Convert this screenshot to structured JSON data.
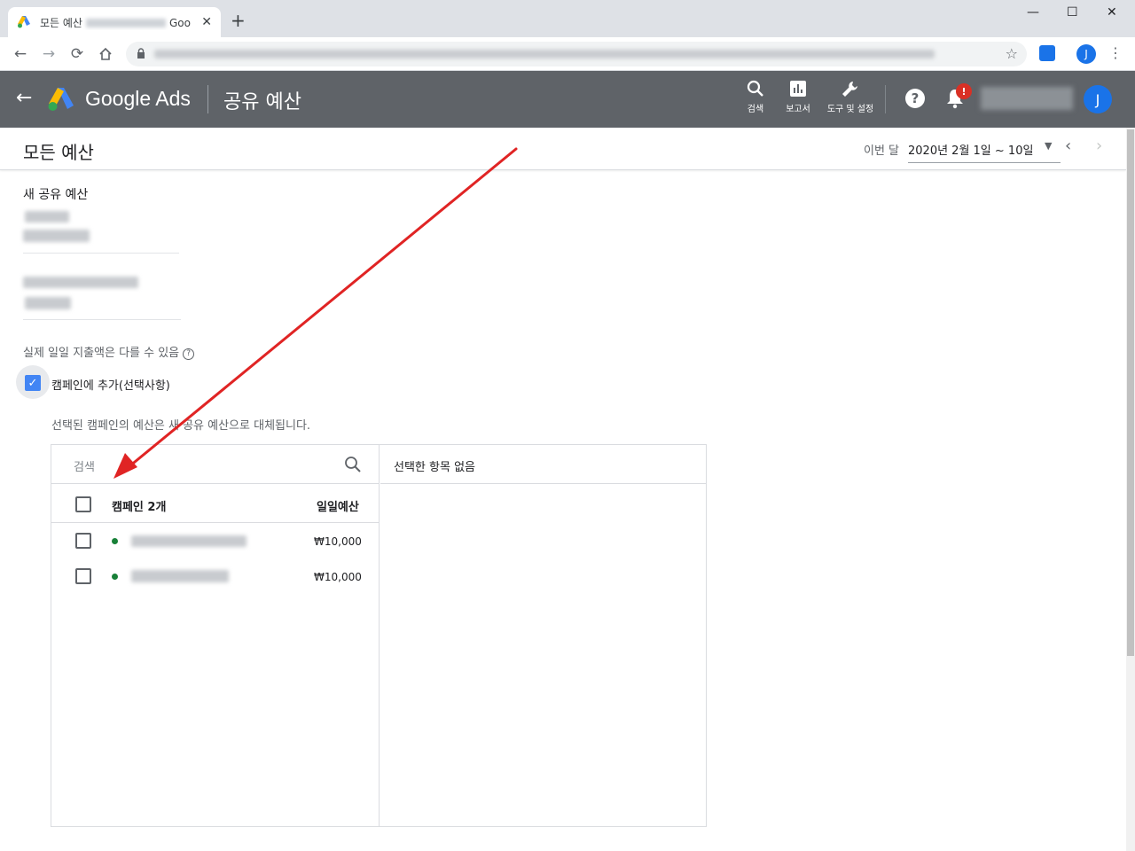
{
  "browser": {
    "tab_title_prefix": "모든 예산",
    "tab_title_suffix": "Goo",
    "tab_close": "✕",
    "new_tab": "+",
    "window_minimize": "—",
    "window_maximize": "☐",
    "window_close": "✕",
    "profile_initial": "J"
  },
  "ads_header": {
    "brand": "Google Ads",
    "page": "공유 예산",
    "tools": [
      {
        "label": "검색",
        "icon": "search-icon"
      },
      {
        "label": "보고서",
        "icon": "reports-icon"
      },
      {
        "label": "도구 및 설정",
        "icon": "wrench-icon"
      }
    ],
    "help_icon": "?",
    "notification_badge": "!",
    "avatar_initial": "J"
  },
  "page_header": {
    "title": "모든 예산",
    "date_label": "이번 달",
    "date_range": "2020년 2월 1일 ~ 10일"
  },
  "form": {
    "section_label": "새 공유 예산",
    "spend_note": "실제 일일 지출액은 다를 수 있음",
    "add_to_campaigns_label": "캠페인에 추가(선택사항)",
    "add_to_campaigns_checked": true,
    "replace_description": "선택된 캠페인의 예산은 새 공유 예산으로 대체됩니다."
  },
  "selector": {
    "search_placeholder": "검색",
    "header_campaigns": "캠페인 2개",
    "header_budget": "일일예산",
    "rows": [
      {
        "budget": "₩10,000",
        "status_color": "#188038"
      },
      {
        "budget": "₩10,000",
        "status_color": "#188038"
      }
    ],
    "selected_empty": "선택한 항목 없음"
  },
  "colors": {
    "ads_header_bg": "#5f6368",
    "accent_blue": "#1a73e8",
    "checkbox_blue": "#4285f4",
    "status_green": "#188038",
    "annotation_red": "#e02424",
    "badge_red": "#d93025"
  }
}
